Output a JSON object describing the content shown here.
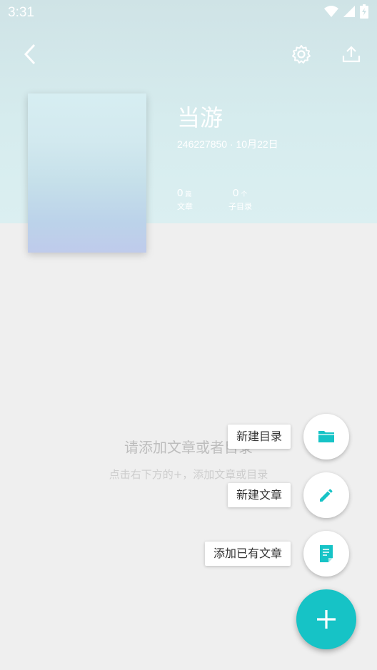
{
  "status_bar": {
    "time": "3:31"
  },
  "header": {
    "title": "当游",
    "meta": "246227850 · 10月22日",
    "stats": [
      {
        "value": "0",
        "unit": "篇",
        "label": "文章"
      },
      {
        "value": "0",
        "unit": "个",
        "label": "子目录"
      }
    ]
  },
  "empty_state": {
    "title": "请添加文章或者目录",
    "hint": "点击右下方的+，添加文章或目录"
  },
  "fab_menu": {
    "items": [
      {
        "label": "新建目录",
        "icon": "folder-icon"
      },
      {
        "label": "新建文章",
        "icon": "pencil-icon"
      },
      {
        "label": "添加已有文章",
        "icon": "document-icon"
      }
    ],
    "main_icon": "plus-icon"
  },
  "colors": {
    "accent": "#16c3c6",
    "header_bg": "#d6ecee",
    "page_bg": "#efefef"
  }
}
